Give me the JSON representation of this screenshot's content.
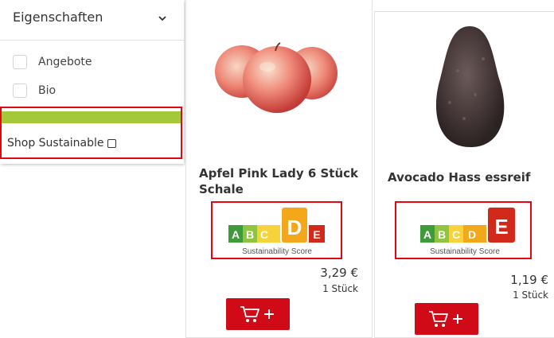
{
  "filter": {
    "title": "Eigenschaften",
    "options": [
      {
        "label": "Angebote",
        "checked": false
      },
      {
        "label": "Bio",
        "checked": false
      }
    ],
    "sustainable_label": "Shop Sustainable",
    "sustainable_checked": false,
    "accent_color": "#a5c83b"
  },
  "products": [
    {
      "name_line1": "Apfel Pink Lady 6 Stück",
      "name_line2": "Schale",
      "price": "3,29 €",
      "unit": "1 Stück",
      "score": "D",
      "score_caption": "Sustainability Score",
      "image": "apple-image"
    },
    {
      "name_line1": "Avocado Hass essreif",
      "price": "1,19 €",
      "unit": "1 Stück",
      "score": "E",
      "score_caption": "Sustainability Score",
      "image": "avocado-image"
    }
  ],
  "score_letters": [
    "A",
    "B",
    "C",
    "D",
    "E"
  ],
  "score_colors": {
    "A": "#3f9a3a",
    "B": "#8fc441",
    "C": "#f6d33a",
    "D": "#f3a71b",
    "E": "#d12a1b"
  },
  "colors": {
    "highlight": "#e30613",
    "button": "#d10a17"
  }
}
